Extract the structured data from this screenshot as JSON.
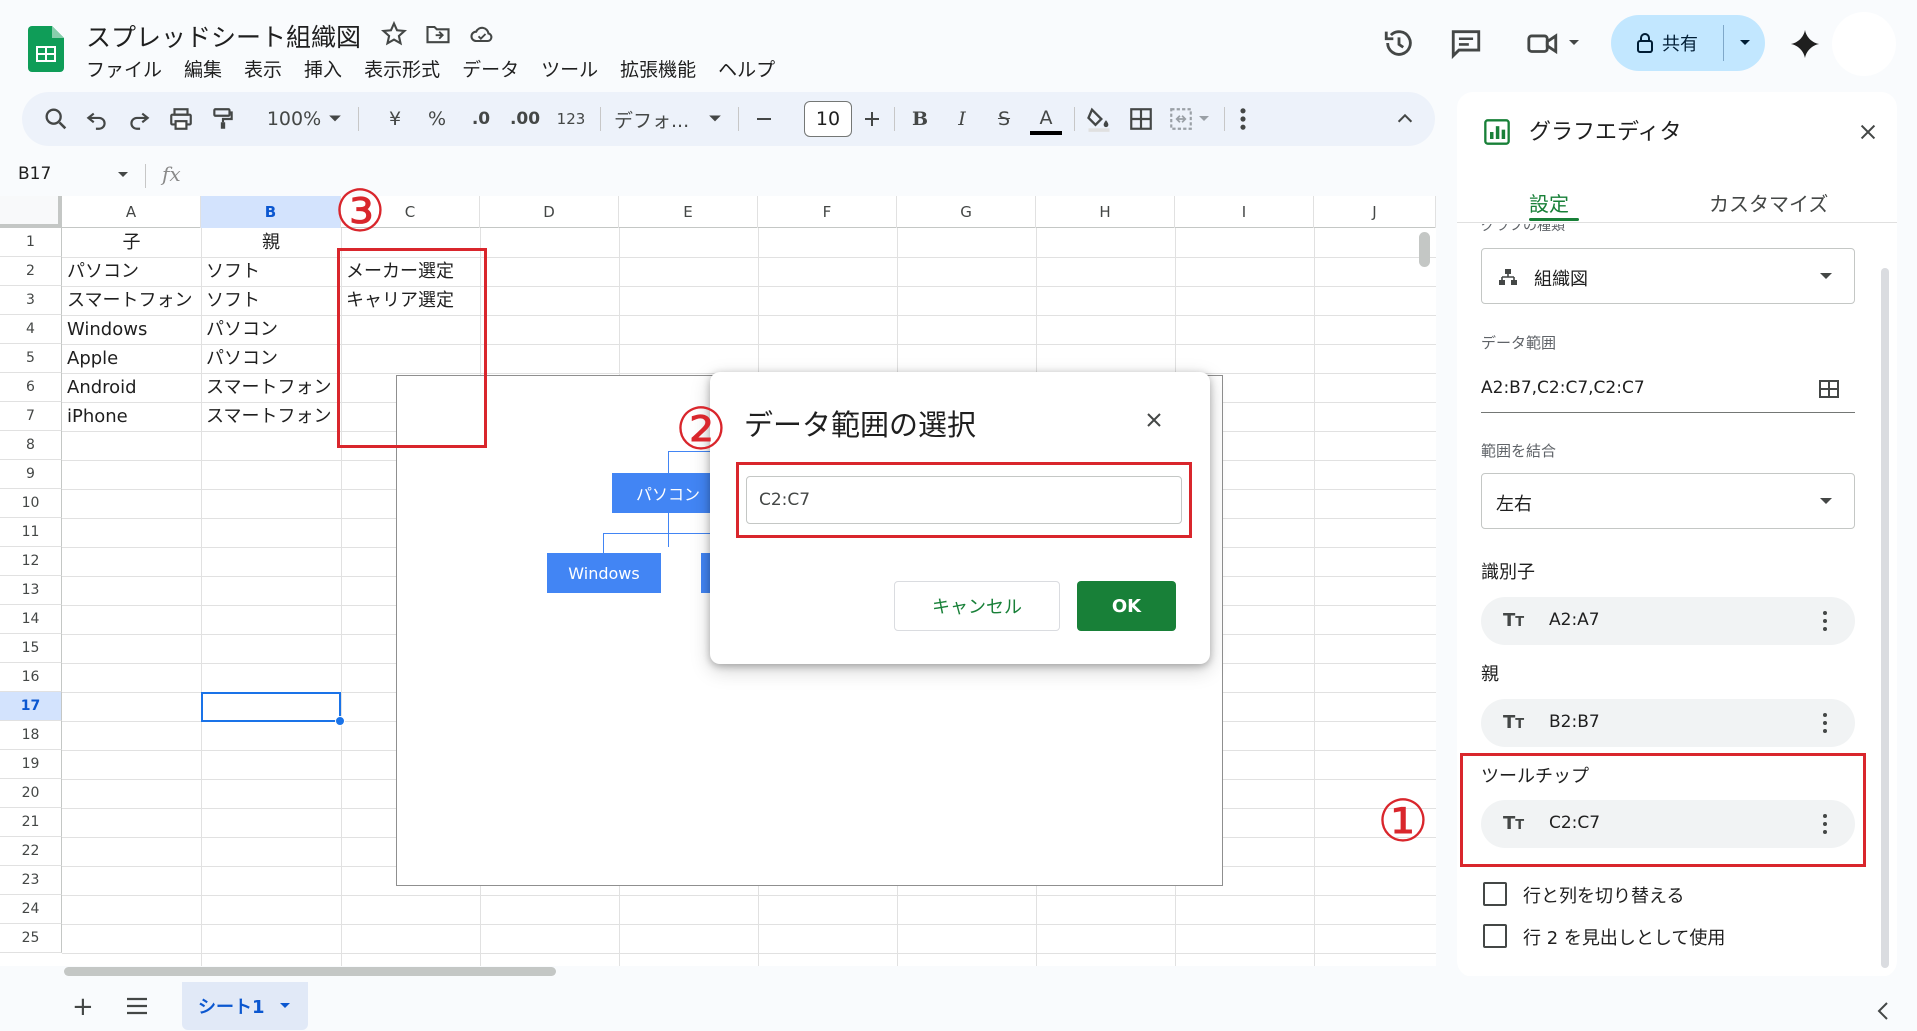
{
  "app": {
    "title": "スプレッドシート組織図",
    "menu": [
      "ファイル",
      "編集",
      "表示",
      "挿入",
      "表示形式",
      "データ",
      "ツール",
      "拡張機能",
      "ヘルプ"
    ],
    "share_label": "共有"
  },
  "toolbar": {
    "zoom": "100%",
    "currency": "¥",
    "percent": "%",
    "dec_less": ".0",
    "dec_more": ".00",
    "number_format": "123",
    "font": "デフォ...",
    "font_size": "10",
    "bold": "B",
    "italic": "I",
    "strike": "S",
    "text_color": "A"
  },
  "formula_bar": {
    "cell_ref": "B17",
    "fx": "fx"
  },
  "grid": {
    "columns": [
      "A",
      "B",
      "C",
      "D",
      "E",
      "F",
      "G",
      "H",
      "I",
      "J"
    ],
    "selected_column": "B",
    "rows": [
      "1",
      "2",
      "3",
      "4",
      "5",
      "6",
      "7",
      "8",
      "9",
      "10",
      "11",
      "12",
      "13",
      "14",
      "15",
      "16",
      "17",
      "18",
      "19",
      "20",
      "21",
      "22",
      "23",
      "24",
      "25"
    ],
    "selected_row": "17",
    "cells": {
      "A1": "子",
      "B1": "親",
      "A2": "パソコン",
      "B2": "ソフト",
      "C2": "メーカー選定",
      "A3": "スマートフォン",
      "B3": "ソフト",
      "C3": "キャリア選定",
      "A4": "Windows",
      "B4": "パソコン",
      "A5": "Apple",
      "B5": "パソコン",
      "A6": "Android",
      "B6": "スマートフォン",
      "A7": "iPhone",
      "B7": "スマートフォン"
    }
  },
  "chart": {
    "nodes": [
      "パソコン",
      "Windows"
    ]
  },
  "dialog": {
    "title": "データ範囲の選択",
    "input_value": "C2:C7",
    "cancel_label": "キャンセル",
    "ok_label": "OK"
  },
  "annotations": {
    "one": "①",
    "two": "②",
    "three": "③",
    "color": "#d9262c"
  },
  "panel": {
    "title": "グラフエディタ",
    "tabs": [
      "設定",
      "カスタマイズ"
    ],
    "chart_type_label_cut": "グラフの種類",
    "chart_type": "組織図",
    "data_range_label": "データ範囲",
    "data_range": "A2:B7,C2:C7,C2:C7",
    "combine_label": "範囲を結合",
    "combine_value": "左右",
    "id_heading": "識別子",
    "id_value": "A2:A7",
    "parent_heading": "親",
    "parent_value": "B2:B7",
    "tooltip_heading": "ツールチップ",
    "tooltip_value": "C2:C7",
    "switch_rows_cols": "行と列を切り替える",
    "use_row_header": "行 2 を見出しとして使用"
  },
  "sheets": {
    "active": "シート1"
  },
  "colors": {
    "accent_green": "#188038",
    "share_bg": "#c2e7ff",
    "node_blue": "#4285f4",
    "selection_blue": "#1a73e8"
  }
}
